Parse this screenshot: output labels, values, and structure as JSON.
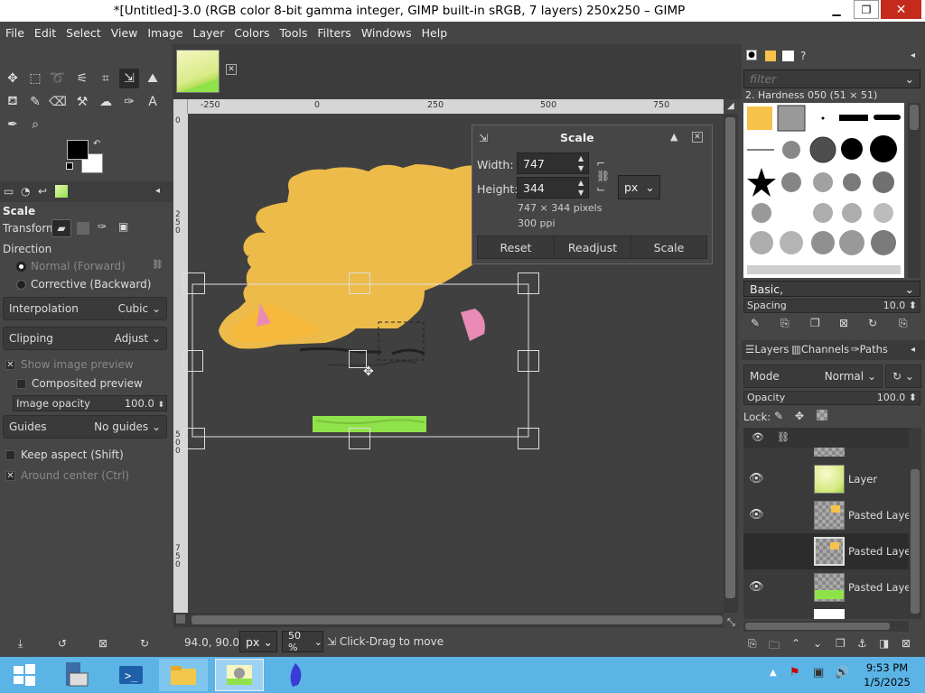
{
  "window": {
    "title": "*[Untitled]-3.0 (RGB color 8-bit gamma integer, GIMP built-in sRGB, 7 layers) 250x250 – GIMP"
  },
  "menu": [
    "File",
    "Edit",
    "Select",
    "View",
    "Image",
    "Layer",
    "Colors",
    "Tools",
    "Filters",
    "Windows",
    "Help"
  ],
  "tool_options": {
    "title": "Scale",
    "transform_label": "Transform:",
    "direction_label": "Direction",
    "direction_normal": "Normal (Forward)",
    "direction_corrective": "Corrective (Backward)",
    "interpolation_label": "Interpolation",
    "interpolation_value": "Cubic",
    "clipping_label": "Clipping",
    "clipping_value": "Adjust",
    "show_preview": "Show image preview",
    "composited_preview": "Composited preview",
    "image_opacity_label": "Image opacity",
    "image_opacity_value": "100.0",
    "guides_label": "Guides",
    "guides_value": "No guides",
    "keep_aspect": "Keep aspect (Shift)",
    "around_center": "Around center (Ctrl)"
  },
  "ruler": {
    "top": [
      "-250",
      "0",
      "250",
      "500",
      "750"
    ],
    "left": [
      "0",
      "2 5 0",
      "5 0 0",
      "7 5 0"
    ]
  },
  "scale_dialog": {
    "title": "Scale",
    "width_label": "Width:",
    "width_value": "747",
    "height_label": "Height:",
    "height_value": "344",
    "unit": "px",
    "size_info": "747 × 344 pixels",
    "resolution": "300 ppi",
    "reset": "Reset",
    "readjust": "Readjust",
    "scale": "Scale"
  },
  "statusbar": {
    "coords": "94.0, 90.0",
    "unit": "px",
    "zoom": "50 %",
    "message": "Click-Drag to move"
  },
  "brushes": {
    "filter_placeholder": "filter",
    "selected": "2. Hardness 050 (51 × 51)",
    "preset": "Basic,",
    "spacing_label": "Spacing",
    "spacing_value": "10.0"
  },
  "layers_panel": {
    "tabs": [
      "Layers",
      "Channels",
      "Paths"
    ],
    "mode_label": "Mode",
    "mode_value": "Normal",
    "opacity_label": "Opacity",
    "opacity_value": "100.0",
    "lock_label": "Lock:",
    "layers": [
      {
        "name": "Layer",
        "visible": true
      },
      {
        "name": "Pasted Layer",
        "visible": true
      },
      {
        "name": "Pasted Layer",
        "visible": false
      },
      {
        "name": "Pasted Layer",
        "visible": true
      }
    ]
  },
  "taskbar": {
    "time": "9:53 PM",
    "date": "1/5/2025"
  },
  "colors": {
    "accent": "#5bb4e5",
    "cat": "#f7c24a",
    "grass": "#8fe34a",
    "close": "#c42b1c"
  }
}
